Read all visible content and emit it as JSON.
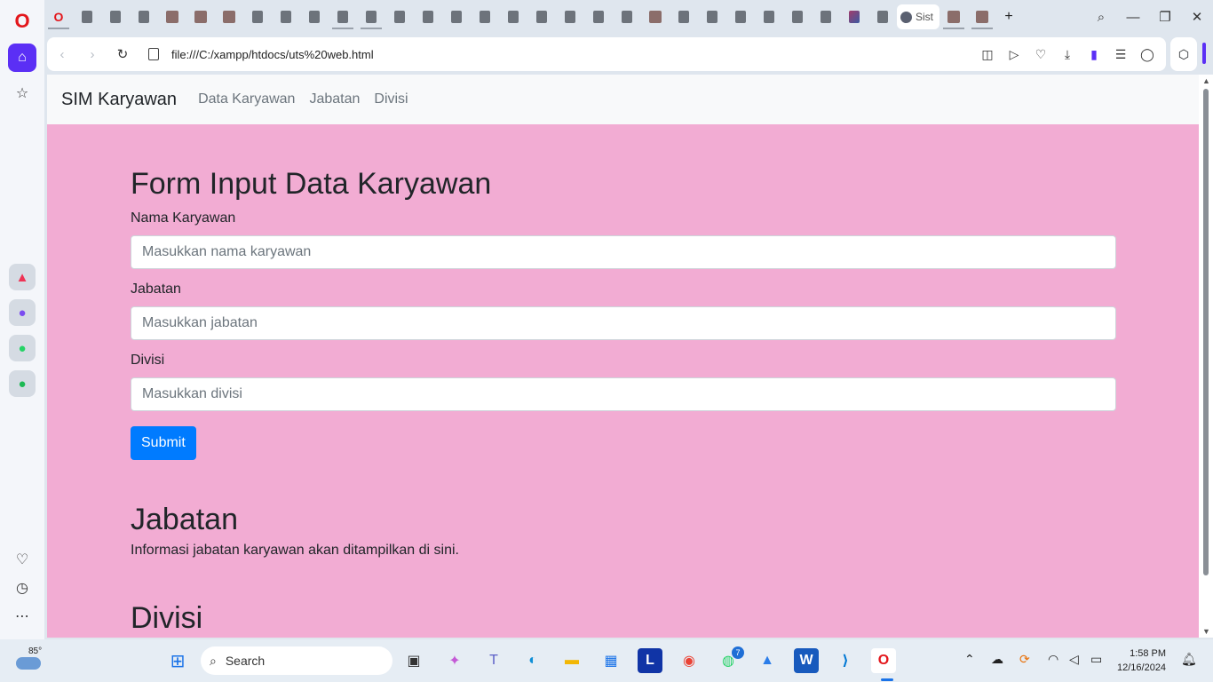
{
  "browser": {
    "active_tab_title": "Sist",
    "url": "file:///C:/xampp/htdocs/uts%20web.html"
  },
  "page": {
    "navbar": {
      "brand": "SIM Karyawan",
      "links": [
        "Data Karyawan",
        "Jabatan",
        "Divisi"
      ]
    },
    "form": {
      "title": "Form Input Data Karyawan",
      "fields": [
        {
          "label": "Nama Karyawan",
          "placeholder": "Masukkan nama karyawan"
        },
        {
          "label": "Jabatan",
          "placeholder": "Masukkan jabatan"
        },
        {
          "label": "Divisi",
          "placeholder": "Masukkan divisi"
        }
      ],
      "submit_label": "Submit"
    },
    "sections": [
      {
        "title": "Jabatan",
        "text": "Informasi jabatan karyawan akan ditampilkan di sini."
      },
      {
        "title": "Divisi"
      }
    ],
    "colors": {
      "background": "#f2acd3",
      "submit": "#007bff",
      "navbar": "#f8f9fa"
    }
  },
  "taskbar": {
    "weather_temp": "85°",
    "search_label": "Search",
    "whatsapp_badge": "7",
    "time": "1:58 PM",
    "date": "12/16/2024"
  }
}
